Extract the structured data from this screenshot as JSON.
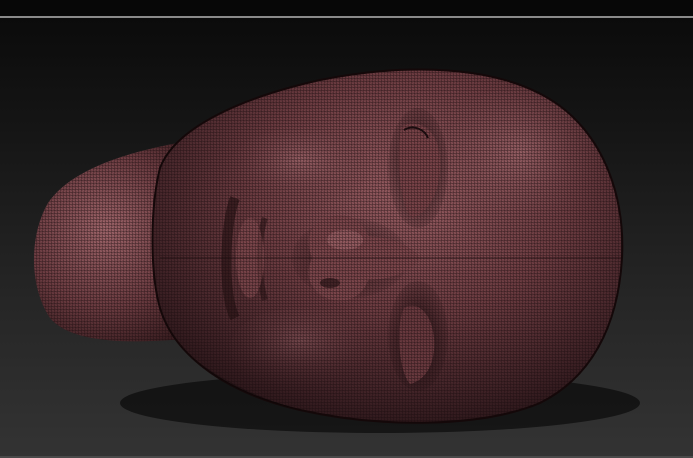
{
  "viewport": {
    "model_name": "sculpted-head-mesh",
    "material": "wireframe-skin",
    "colors": {
      "background_top": "#0b0b0b",
      "background_bottom": "#333333",
      "mesh_base": "#5a3034",
      "mesh_highlight": "#a8676c",
      "wire": "#1a0c0e",
      "border": "#8a8a8a"
    }
  }
}
